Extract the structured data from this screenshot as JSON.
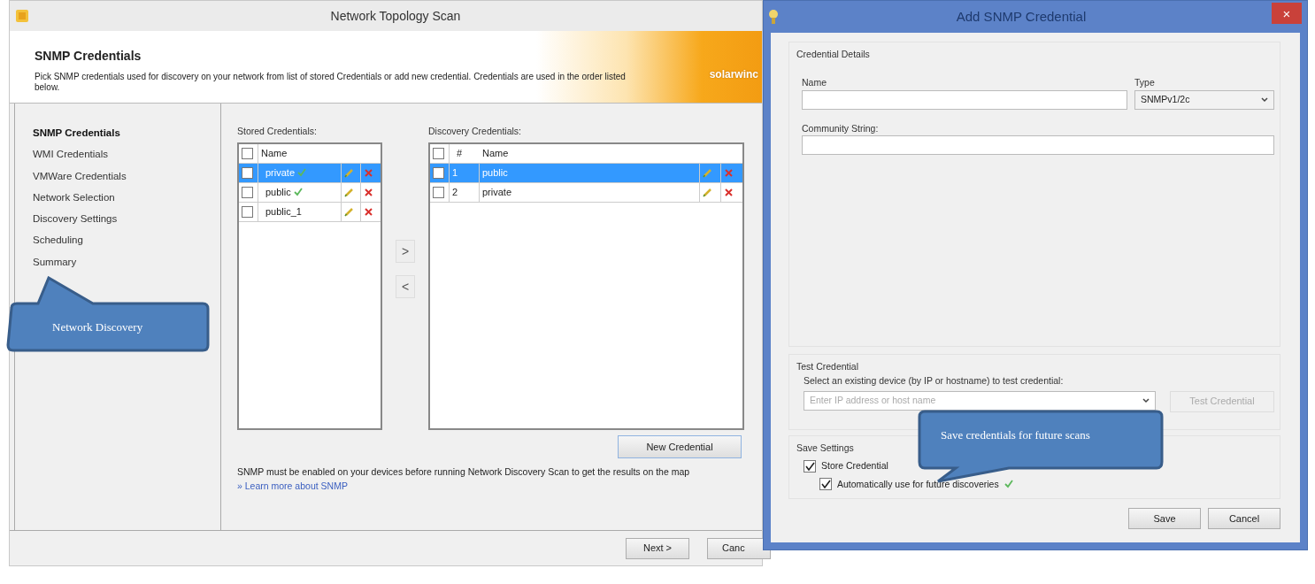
{
  "window": {
    "title": "Network Topology Scan"
  },
  "header": {
    "title": "SNMP Credentials",
    "description": "Pick SNMP credentials used for discovery on your network from list of stored Credentials or add new credential. Credentials are used in the order listed below.",
    "logo_text": "solarwinc"
  },
  "sidebar": {
    "items": [
      {
        "label": "SNMP Credentials",
        "selected": true
      },
      {
        "label": "WMI Credentials",
        "selected": false
      },
      {
        "label": "VMWare Credentials",
        "selected": false
      },
      {
        "label": "Network Selection",
        "selected": false
      },
      {
        "label": "Discovery Settings",
        "selected": false
      },
      {
        "label": "Scheduling",
        "selected": false
      },
      {
        "label": "Summary",
        "selected": false
      }
    ]
  },
  "stored_credentials": {
    "label": "Stored Credentials:",
    "header_checked": false,
    "columns": [
      "Name"
    ],
    "rows": [
      {
        "name": "private",
        "checked": false,
        "selected": true,
        "verified": true
      },
      {
        "name": "public",
        "checked": false,
        "selected": false,
        "verified": true
      },
      {
        "name": "public_1",
        "checked": false,
        "selected": false,
        "verified": false
      }
    ]
  },
  "move_buttons": [
    ">",
    "<"
  ],
  "discovery_credentials": {
    "label": "Discovery Credentials:",
    "header_checked": false,
    "columns": [
      "#",
      "Name"
    ],
    "rows": [
      {
        "number": "1",
        "name": "public",
        "checked": false,
        "selected": true
      },
      {
        "number": "2",
        "name": "private",
        "checked": false,
        "selected": false
      }
    ]
  },
  "new_credential_button": "New Credential",
  "note": "SNMP must be enabled on your devices before running Network Discovery Scan to get the results on the map",
  "learn_more_link": "» Learn more about SNMP",
  "footer_buttons": [
    "Next >",
    "Canc"
  ],
  "dialog": {
    "title": "Add SNMP Credential",
    "close": "×",
    "details": {
      "label": "Credential Details",
      "name_label": "Name",
      "type_label": "Type",
      "type_value": "SNMPv1/2c",
      "community_label": "Community String:"
    },
    "test": {
      "label": "Test Credential",
      "hint": "Select an existing device (by IP or hostname) to test credential:",
      "placeholder": "Enter IP address or host name",
      "button": "Test Credential",
      "button_disabled": true
    },
    "save_settings": {
      "label": "Save Settings",
      "options": [
        {
          "label": "Store Credential",
          "checked": true,
          "verified": false
        },
        {
          "label": "Automatically use for future discoveries",
          "checked": true,
          "verified": true
        }
      ]
    },
    "buttons": [
      "Save",
      "Cancel"
    ]
  },
  "callouts": [
    {
      "text": "Network Discovery",
      "kind": "up"
    },
    {
      "text": "Save credentials for future scans",
      "kind": "down"
    }
  ]
}
